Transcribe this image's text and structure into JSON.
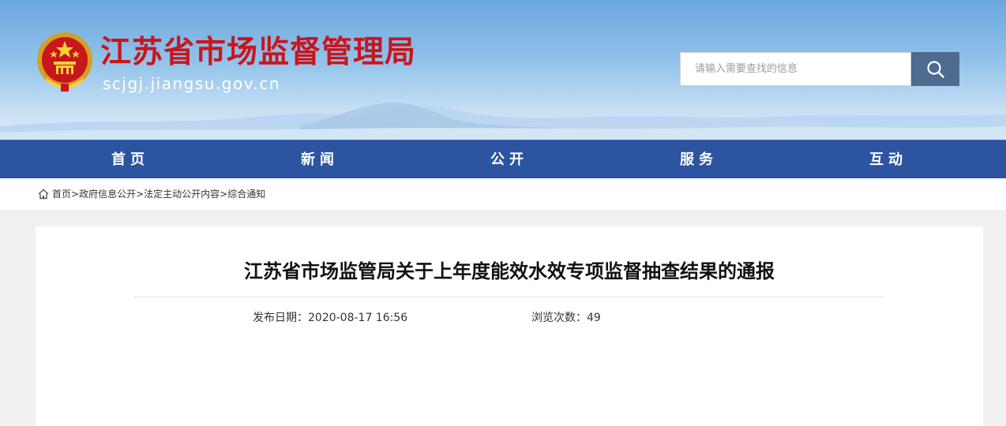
{
  "header": {
    "site_title": "江苏省市场监督管理局",
    "site_url": "scjgj.jiangsu.gov.cn",
    "emblem_icon": "national-emblem-icon",
    "search": {
      "placeholder": "请输入需要查找的信息",
      "button_icon": "search-icon"
    }
  },
  "nav": {
    "items": [
      {
        "label": "首页"
      },
      {
        "label": "新闻"
      },
      {
        "label": "公开"
      },
      {
        "label": "服务"
      },
      {
        "label": "互动"
      }
    ]
  },
  "breadcrumb": {
    "home_icon": "home-icon",
    "items": [
      "首页",
      "政府信息公开",
      "法定主动公开内容",
      "综合通知"
    ],
    "separator": ">"
  },
  "article": {
    "title": "江苏省市场监管局关于上年度能效水效专项监督抽查结果的通报",
    "publish_label": "发布日期：",
    "publish_date": "2020-08-17 16:56",
    "views_label": "浏览次数：",
    "views": "49"
  },
  "colors": {
    "title_red": "#c8161d",
    "nav_blue": "#2c54a0",
    "search_button": "#4d6b8f"
  }
}
